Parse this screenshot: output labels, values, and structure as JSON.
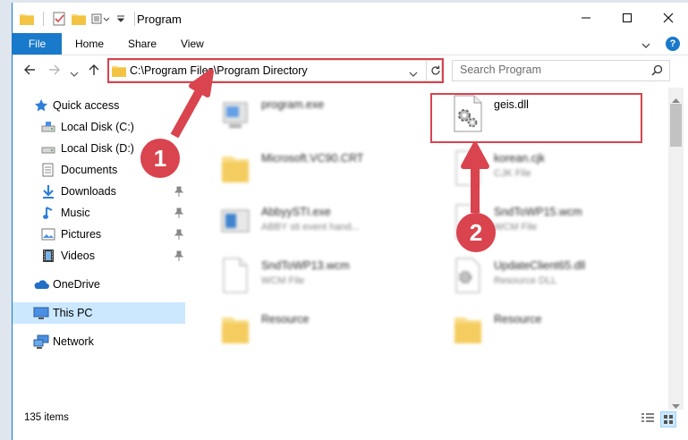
{
  "window": {
    "title": "Program",
    "controls": {
      "minimize": "minimize",
      "maximize": "maximize",
      "close": "close"
    }
  },
  "ribbon": {
    "tabs": [
      "File",
      "Home",
      "Share",
      "View"
    ],
    "help_label": "?"
  },
  "address": {
    "path": "C:\\Program Files\\Program Directory"
  },
  "search": {
    "placeholder": "Search Program"
  },
  "sidebar": {
    "items": [
      {
        "label": "Quick access",
        "icon": "star-icon"
      },
      {
        "label": "Local Disk (C:)",
        "icon": "drive-icon"
      },
      {
        "label": "Local Disk (D:)",
        "icon": "drive-icon"
      },
      {
        "label": "Documents",
        "icon": "documents-icon"
      },
      {
        "label": "Downloads",
        "icon": "download-icon"
      },
      {
        "label": "Music",
        "icon": "music-icon"
      },
      {
        "label": "Pictures",
        "icon": "pictures-icon"
      },
      {
        "label": "Videos",
        "icon": "videos-icon"
      },
      {
        "label": "OneDrive",
        "icon": "cloud-icon"
      },
      {
        "label": "This PC",
        "icon": "computer-icon"
      },
      {
        "label": "Network",
        "icon": "network-icon"
      }
    ]
  },
  "files": [
    {
      "name": "program.exe",
      "sub": "",
      "type": "exe"
    },
    {
      "name": "geis.dll",
      "sub": "",
      "type": "dll"
    },
    {
      "name": "Microsoft.VC90.CRT",
      "sub": "",
      "type": "folder"
    },
    {
      "name": "korean.cjk",
      "sub": "CJK File",
      "type": "file"
    },
    {
      "name": "AbbyySTI.exe",
      "sub": "ABBY sti event hand...",
      "type": "exe2"
    },
    {
      "name": "SndToWP15.wcm",
      "sub": "WCM File",
      "type": "file"
    },
    {
      "name": "SndToWP13.wcm",
      "sub": "WCM File",
      "type": "file"
    },
    {
      "name": "UpdateClient65.dll",
      "sub": "Resource DLL",
      "type": "dll"
    },
    {
      "name": "Resource",
      "sub": "",
      "type": "folder"
    },
    {
      "name": "Resource",
      "sub": "",
      "type": "folder"
    }
  ],
  "status": {
    "item_count": "135 items"
  },
  "callouts": {
    "step1": "1",
    "step2": "2"
  },
  "colors": {
    "accent": "#1979ca",
    "highlight": "#d9444e",
    "selected": "#cce8ff"
  }
}
